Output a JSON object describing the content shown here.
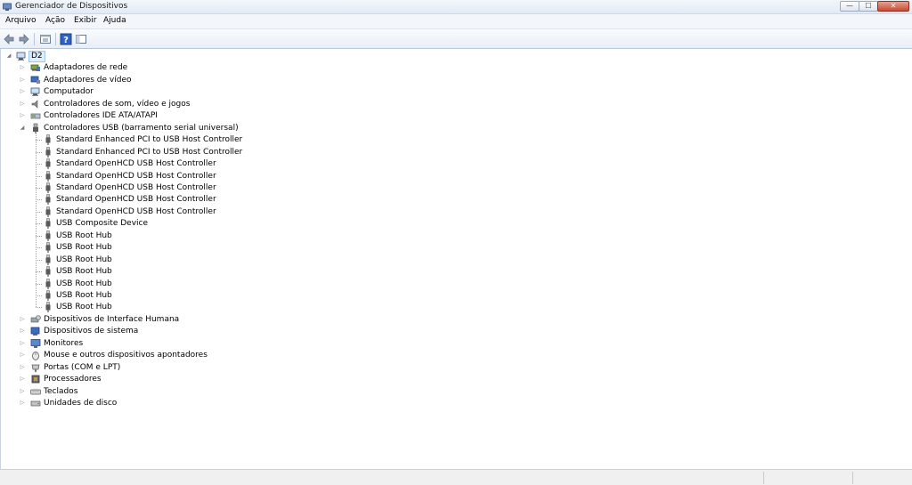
{
  "window": {
    "title": "Gerenciador de Dispositivos",
    "min_glyph": "—",
    "max_glyph": "☐",
    "close_glyph": "✕"
  },
  "menu": [
    "Arquivo",
    "Ação",
    "Exibir",
    "Ajuda"
  ],
  "toolbar": {
    "icons": [
      "back-arrow-icon",
      "forward-arrow-icon",
      "properties-view-icon",
      "help-icon",
      "console-view-icon"
    ]
  },
  "tree": {
    "root": {
      "label": "D2",
      "icon": "computer-icon",
      "expander": "◢"
    },
    "categories_before": [
      {
        "label": "Adaptadores de rede",
        "icon": "network-adapter-icon"
      },
      {
        "label": "Adaptadores de vídeo",
        "icon": "display-adapter-icon"
      },
      {
        "label": "Computador",
        "icon": "computer-icon"
      },
      {
        "label": "Controladores de som, vídeo e jogos",
        "icon": "speaker-icon"
      },
      {
        "label": "Controladores IDE ATA/ATAPI",
        "icon": "ide-controller-icon"
      }
    ],
    "usb_category": {
      "label": "Controladores USB (barramento serial universal)",
      "icon": "usb-icon",
      "children": [
        "Standard Enhanced PCI to USB Host Controller",
        "Standard Enhanced PCI to USB Host Controller",
        "Standard OpenHCD USB Host Controller",
        "Standard OpenHCD USB Host Controller",
        "Standard OpenHCD USB Host Controller",
        "Standard OpenHCD USB Host Controller",
        "Standard OpenHCD USB Host Controller",
        "USB Composite Device",
        "USB Root Hub",
        "USB Root Hub",
        "USB Root Hub",
        "USB Root Hub",
        "USB Root Hub",
        "USB Root Hub",
        "USB Root Hub"
      ]
    },
    "categories_after": [
      {
        "label": "Dispositivos de Interface Humana",
        "icon": "hid-icon"
      },
      {
        "label": "Dispositivos de sistema",
        "icon": "system-device-icon"
      },
      {
        "label": "Monitores",
        "icon": "monitor-icon"
      },
      {
        "label": "Mouse e outros dispositivos apontadores",
        "icon": "mouse-icon"
      },
      {
        "label": "Portas (COM e LPT)",
        "icon": "port-icon"
      },
      {
        "label": "Processadores",
        "icon": "processor-icon"
      },
      {
        "label": "Teclados",
        "icon": "keyboard-icon"
      },
      {
        "label": "Unidades de disco",
        "icon": "disk-drive-icon"
      }
    ],
    "collapsed_glyph": "▷",
    "expanded_glyph": "◢"
  },
  "colors": {
    "accent": "#3a6fb8",
    "usb_gray": "#5a5a5a",
    "root_highlight": "#ddeefe"
  }
}
